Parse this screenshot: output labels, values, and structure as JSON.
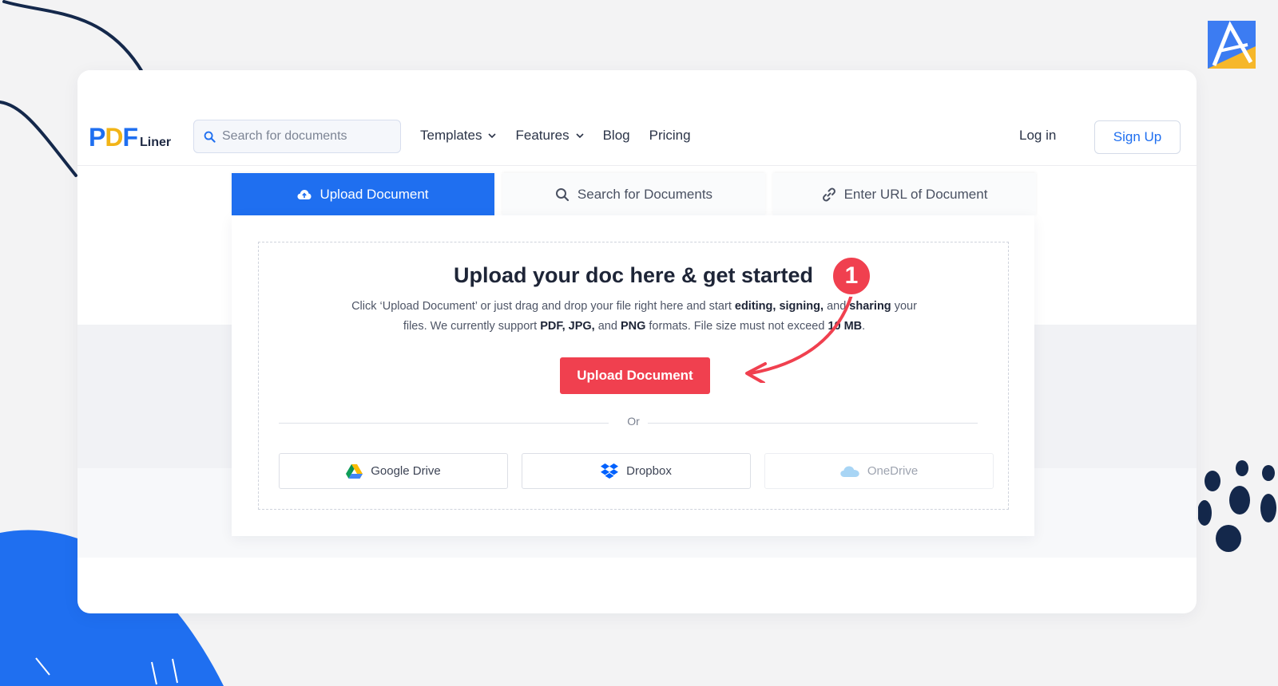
{
  "header": {
    "logo": {
      "pdf_p": "P",
      "pdf_d": "D",
      "pdf_f": "F",
      "liner": "Liner"
    },
    "search": {
      "placeholder": "Search for documents"
    },
    "nav": [
      {
        "label": "Templates",
        "has_dropdown": true
      },
      {
        "label": "Features",
        "has_dropdown": true
      },
      {
        "label": "Blog",
        "has_dropdown": false
      },
      {
        "label": "Pricing",
        "has_dropdown": false
      }
    ],
    "login_label": "Log in",
    "signup_label": "Sign Up"
  },
  "tabs": [
    {
      "label": "Upload Document",
      "icon": "cloud-upload-icon",
      "active": true
    },
    {
      "label": "Search for Documents",
      "icon": "search-icon",
      "active": false
    },
    {
      "label": "Enter URL of Document",
      "icon": "link-icon",
      "active": false
    }
  ],
  "upload": {
    "title": "Upload your doc here & get started",
    "desc_1": "Click ‘Upload Document’ or just drag and drop your file right here and start ",
    "desc_b1": "editing, signing,",
    "desc_2": " and ",
    "desc_b2": "sharing",
    "desc_3": " your files. We currently support ",
    "desc_b3": "PDF, JPG,",
    "desc_4": " and ",
    "desc_b4": "PNG",
    "desc_5": " formats. File size must not exceed ",
    "desc_b5": "10 MB",
    "desc_6": ".",
    "button_label": "Upload Document",
    "or_label": "Or",
    "cloud_options": [
      {
        "label": "Google Drive",
        "icon": "google-drive-icon",
        "enabled": true
      },
      {
        "label": "Dropbox",
        "icon": "dropbox-icon",
        "enabled": true
      },
      {
        "label": "OneDrive",
        "icon": "onedrive-icon",
        "enabled": false
      }
    ]
  },
  "annotation": {
    "step_number": "1"
  },
  "colors": {
    "brand_blue": "#1f6ff0",
    "accent_red": "#f0404f",
    "logo_yellow": "#f2b417",
    "navy": "#14284b"
  }
}
